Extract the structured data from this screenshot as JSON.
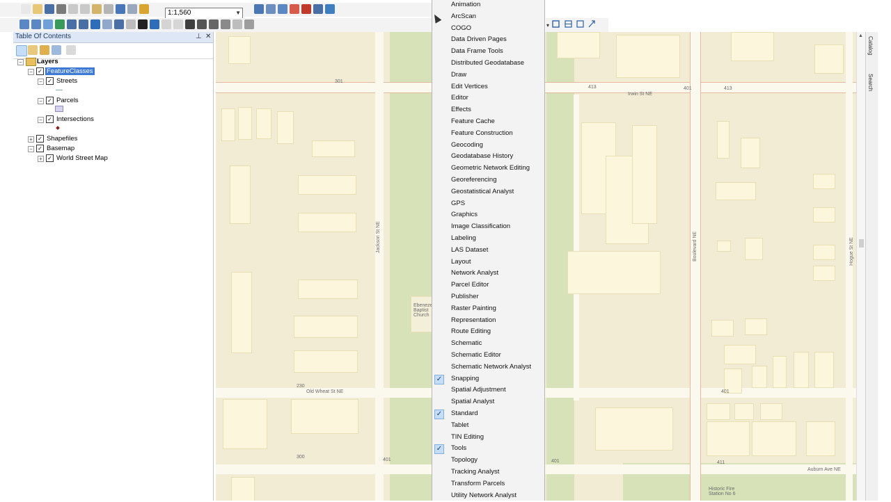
{
  "toolbar": {
    "scale_value": "1:1,560",
    "icons_row1": [
      "new-icon",
      "open-icon",
      "save-icon",
      "print-icon",
      "cut-icon",
      "copy-icon",
      "paste-icon",
      "delete-icon",
      "undo-icon",
      "redo-icon",
      "add-data-icon"
    ],
    "icons_row1_after": [
      "editor-toolbar-icon",
      "toc-window-icon",
      "catalog-window-icon",
      "search-window-icon",
      "arctoolbox-icon",
      "python-icon",
      "model-builder-icon"
    ],
    "icons_row2": [
      "zoom-in-icon",
      "zoom-out-icon",
      "pan-icon",
      "full-extent-icon",
      "fixed-zoom-in-icon",
      "fixed-zoom-out-icon",
      "back-extent-icon",
      "forward-extent-icon",
      "select-features-icon",
      "clear-selection-icon",
      "select-elements-icon",
      "identify-icon",
      "hyperlink-icon",
      "html-popup-icon",
      "measure-icon",
      "find-icon",
      "find-route-icon",
      "go-to-xy-icon",
      "time-slider-icon",
      "viewer-window-icon"
    ]
  },
  "toc": {
    "title": "Table Of Contents",
    "pin_symbol": "📌",
    "close_symbol": "✕",
    "tools": [
      "list-by-drawing-order-icon",
      "list-by-source-icon",
      "list-by-visibility-icon",
      "list-by-selection-icon",
      "options-icon"
    ],
    "root_label": "Layers",
    "items": [
      {
        "label": "FeatureClasses",
        "level": 1,
        "checked": true,
        "expanded": true,
        "selected": true
      },
      {
        "label": "Streets",
        "level": 2,
        "checked": true,
        "expanded": true,
        "symbol": "line",
        "symbol_color": "#7fb3a5"
      },
      {
        "label": "Parcels",
        "level": 2,
        "checked": true,
        "expanded": true,
        "symbol": "fill",
        "symbol_color": "#d5d3f0"
      },
      {
        "label": "Intersections",
        "level": 2,
        "checked": true,
        "expanded": true,
        "symbol": "point",
        "symbol_color": "#8b1c1c"
      },
      {
        "label": "Shapefiles",
        "level": 1,
        "checked": true,
        "expanded": false
      },
      {
        "label": "Basemap",
        "level": 1,
        "checked": true,
        "expanded": true
      },
      {
        "label": "World Street Map",
        "level": 2,
        "checked": true,
        "expanded": false
      }
    ]
  },
  "menu": {
    "items": [
      {
        "label": "Animation",
        "checked": false
      },
      {
        "label": "ArcScan",
        "checked": false
      },
      {
        "label": "COGO",
        "checked": false
      },
      {
        "label": "Data Driven Pages",
        "checked": false
      },
      {
        "label": "Data Frame Tools",
        "checked": false
      },
      {
        "label": "Distributed Geodatabase",
        "checked": false
      },
      {
        "label": "Draw",
        "checked": false
      },
      {
        "label": "Edit Vertices",
        "checked": false
      },
      {
        "label": "Editor",
        "checked": false
      },
      {
        "label": "Effects",
        "checked": false
      },
      {
        "label": "Feature Cache",
        "checked": false
      },
      {
        "label": "Feature Construction",
        "checked": false
      },
      {
        "label": "Geocoding",
        "checked": false
      },
      {
        "label": "Geodatabase History",
        "checked": false
      },
      {
        "label": "Geometric Network Editing",
        "checked": false
      },
      {
        "label": "Georeferencing",
        "checked": false
      },
      {
        "label": "Geostatistical Analyst",
        "checked": false
      },
      {
        "label": "GPS",
        "checked": false
      },
      {
        "label": "Graphics",
        "checked": false
      },
      {
        "label": "Image Classification",
        "checked": false
      },
      {
        "label": "Labeling",
        "checked": false
      },
      {
        "label": "LAS Dataset",
        "checked": false
      },
      {
        "label": "Layout",
        "checked": false
      },
      {
        "label": "Network Analyst",
        "checked": false
      },
      {
        "label": "Parcel Editor",
        "checked": false
      },
      {
        "label": "Publisher",
        "checked": false
      },
      {
        "label": "Raster Painting",
        "checked": false
      },
      {
        "label": "Representation",
        "checked": false
      },
      {
        "label": "Route Editing",
        "checked": false
      },
      {
        "label": "Schematic",
        "checked": false
      },
      {
        "label": "Schematic Editor",
        "checked": false
      },
      {
        "label": "Schematic Network Analyst",
        "checked": false
      },
      {
        "label": "Snapping",
        "checked": true
      },
      {
        "label": "Spatial Adjustment",
        "checked": false
      },
      {
        "label": "Spatial Analyst",
        "checked": false
      },
      {
        "label": "Standard",
        "checked": true
      },
      {
        "label": "Tablet",
        "checked": false
      },
      {
        "label": "TIN Editing",
        "checked": false
      },
      {
        "label": "Tools",
        "checked": true
      },
      {
        "label": "Topology",
        "checked": false
      },
      {
        "label": "Tracking Analyst",
        "checked": false
      },
      {
        "label": "Transform Parcels",
        "checked": false
      },
      {
        "label": "Utility Network Analyst",
        "checked": false
      }
    ],
    "check_symbol": "✓"
  },
  "map": {
    "street_labels": {
      "irwin": "Irwin St NE",
      "old_wheat": "Old Wheat St NE",
      "auburn": "Auburn Ave NE",
      "jackson": "Jackson St NE",
      "boulevard": "Boulevard NE",
      "hogue": "Hogue St NE"
    },
    "poi_labels": {
      "church": "Ebenezer Baptist Church",
      "fire_station": "Historic Fire Station No 6"
    },
    "address_numbers": [
      "301",
      "413",
      "401",
      "413",
      "230",
      "401",
      "401",
      "401",
      "300",
      "411"
    ]
  },
  "side_tabs": {
    "catalog": "Catalog",
    "search": "Search"
  }
}
